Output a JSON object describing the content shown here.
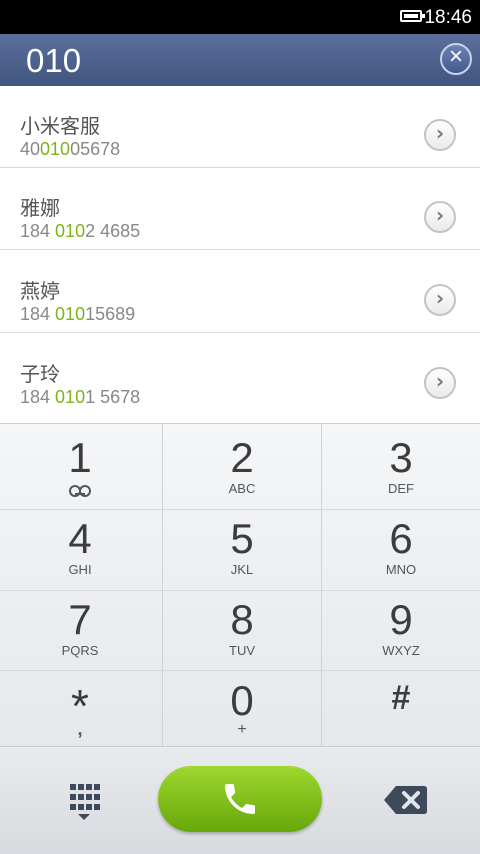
{
  "status_bar": {
    "time": "18:46",
    "icons": [
      "battery-icon"
    ]
  },
  "search": {
    "query": "010",
    "clear_icon": "close-icon"
  },
  "results": [
    {
      "name": "小米客服",
      "number_pre": "40",
      "number_match": "010",
      "number_post": "05678"
    },
    {
      "name": "雅娜",
      "number_pre": "184 ",
      "number_match": "010",
      "number_post": "2 4685"
    },
    {
      "name": "燕婷",
      "number_pre": "184 ",
      "number_match": "010",
      "number_post": "15689"
    },
    {
      "name": "子玲",
      "number_pre": "184 ",
      "number_match": "010",
      "number_post": "1 5678"
    }
  ],
  "keypad": {
    "keys": [
      {
        "digit": "1",
        "letters": ""
      },
      {
        "digit": "2",
        "letters": "ABC"
      },
      {
        "digit": "3",
        "letters": "DEF"
      },
      {
        "digit": "4",
        "letters": "GHI"
      },
      {
        "digit": "5",
        "letters": "JKL"
      },
      {
        "digit": "6",
        "letters": "MNO"
      },
      {
        "digit": "7",
        "letters": "PQRS"
      },
      {
        "digit": "8",
        "letters": "TUV"
      },
      {
        "digit": "9",
        "letters": "WXYZ"
      },
      {
        "digit": "*",
        "letters": ","
      },
      {
        "digit": "0",
        "letters": "+"
      },
      {
        "digit": "#",
        "letters": ""
      }
    ]
  },
  "bottom_bar": {
    "keypad_toggle_icon": "dialpad-icon",
    "call_icon": "phone-icon",
    "backspace_icon": "backspace-icon"
  },
  "colors": {
    "header": "#4a5f8e",
    "match_highlight": "#7cb518",
    "call_button": "#7fbf15"
  }
}
